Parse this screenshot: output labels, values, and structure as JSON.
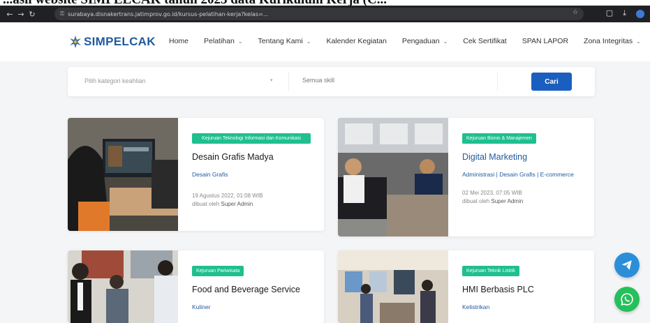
{
  "caption": "...asil website SIMPELCAK tahun 2023 data Kurikulum Kerja (C...",
  "browser": {
    "url": "surabaya.disnakertrans.jatimprov.go.id/kursus-pelatihan-kerja?kelas=...",
    "icons": [
      "back-icon",
      "forward-icon",
      "reload-icon",
      "lock-icon",
      "star-icon",
      "extensions-icon",
      "download-icon",
      "profile-icon"
    ]
  },
  "site": {
    "logo_text": "SIMPELCAK",
    "nav": [
      {
        "label": "Home",
        "dropdown": false
      },
      {
        "label": "Pelatihan",
        "dropdown": true
      },
      {
        "label": "Tentang Kami",
        "dropdown": true
      },
      {
        "label": "Kalender Kegiatan",
        "dropdown": false
      },
      {
        "label": "Pengaduan",
        "dropdown": true
      },
      {
        "label": "Cek Sertifikat",
        "dropdown": false
      },
      {
        "label": "SPAN LAPOR",
        "dropdown": false
      },
      {
        "label": "Zona Integritas",
        "dropdown": true
      }
    ]
  },
  "search": {
    "category_placeholder": "Pilih kategori keahlian",
    "skill_placeholder": "Semua skill",
    "button_label": "Cari"
  },
  "cards": [
    {
      "badge": "Kejuruan Teknologi Informasi dan Komunikasi",
      "title": "Desain Grafis Madya",
      "tags": "Desain Grafis",
      "date": "19 Agustus 2022, 01:08 WIB",
      "author_prefix": "dibuat oleh",
      "author": "Super Admin"
    },
    {
      "badge": "Kejuruan Bisnis & Manajemen",
      "title": "Digital Marketing",
      "tags": "Administrasi | Desain Grafis | E-commerce",
      "date": "02 Mei 2023, 07:05 WIB",
      "author_prefix": "dibuat oleh",
      "author": "Super Admin"
    },
    {
      "badge": "Kejuruan Pariwisata",
      "title": "Food and Beverage Service",
      "tags": "Kuliner"
    },
    {
      "badge": "Kejuruan Teknik Listrik",
      "title": "HMI Berbasis PLC",
      "tags": "Kelistrikan"
    }
  ],
  "colors": {
    "brand": "#1f5a9e",
    "badge": "#1fbf8f",
    "button": "#1a5fc0",
    "telegram": "#2a8fd8",
    "whatsapp": "#25c05a"
  },
  "fab": [
    "telegram-icon",
    "whatsapp-icon"
  ]
}
